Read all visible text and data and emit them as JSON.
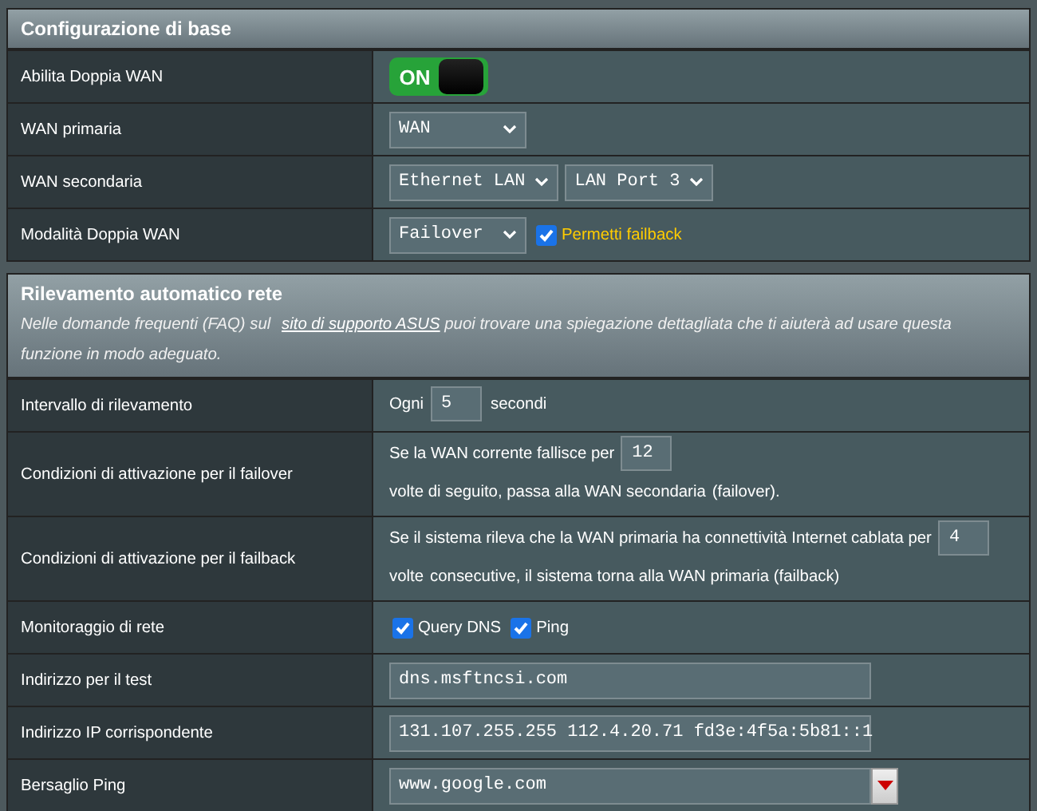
{
  "sections": [
    {
      "title": "Configurazione di base",
      "rows": [
        {
          "kind": "toggle",
          "label": "Abilita Doppia WAN",
          "toggle": {
            "text": "ON",
            "on": true
          }
        },
        {
          "kind": "selects",
          "label": "WAN primaria",
          "selects": [
            "WAN"
          ]
        },
        {
          "kind": "selects",
          "label": "WAN secondaria",
          "selects": [
            "Ethernet LAN",
            "LAN Port 3"
          ]
        },
        {
          "kind": "selects",
          "label": "Modalità Doppia WAN",
          "selects": [
            "Failover"
          ],
          "checks": [
            {
              "label": "Permetti failback",
              "checked": true
            }
          ]
        }
      ]
    },
    {
      "title": "Rilevamento automatico rete",
      "note": {
        "before": "Nelle domande frequenti (FAQ) sul ",
        "link": "sito di supporto ASUS",
        "after": " puoi trovare una spiegazione dettagliata che ti aiuterà ad usare questa funzione in modo adeguato."
      },
      "rows": [
        {
          "kind": "sentence",
          "label": "Intervallo di rilevamento",
          "parts": [
            {
              "text": "Ogni"
            },
            {
              "input": "5"
            },
            {
              "text": "secondi"
            }
          ]
        },
        {
          "kind": "sentence",
          "label": "Condizioni di attivazione per il failover",
          "parts": [
            {
              "text": "Se la WAN corrente fallisce per"
            },
            {
              "input": "12"
            },
            {
              "text": "volte di seguito, passa alla WAN secondaria"
            },
            {
              "text": "(failover)."
            }
          ]
        },
        {
          "kind": "sentence",
          "label": "Condizioni di attivazione per il failback",
          "parts": [
            {
              "text": "Se il sistema rileva che la WAN primaria ha connettività Internet cablata per"
            },
            {
              "input": "4"
            },
            {
              "text": "volte"
            },
            {
              "text": "consecutive, il sistema torna alla WAN primaria (failback)"
            }
          ]
        },
        {
          "kind": "checks",
          "label": "Monitoraggio di rete",
          "checks": [
            {
              "label": "Query DNS",
              "checked": true
            },
            {
              "label": "Ping",
              "checked": true
            }
          ]
        },
        {
          "kind": "input",
          "label": "Indirizzo per il test",
          "value": "dns.msftncsi.com"
        },
        {
          "kind": "input",
          "label": "Indirizzo IP corrispondente",
          "value": "131.107.255.255 112.4.20.71 fd3e:4f5a:5b81::1"
        },
        {
          "kind": "combo",
          "label": "Bersaglio Ping",
          "value": "www.google.com"
        }
      ]
    }
  ]
}
